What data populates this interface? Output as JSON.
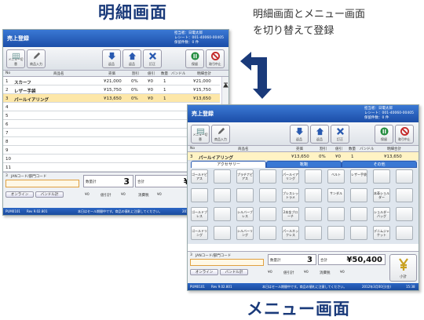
{
  "captions": {
    "detail_title": "明細画面",
    "menu_title": "メニュー画面",
    "description_line1": "明細画面とメニュー画面",
    "description_line2": "を切り替えて登録"
  },
  "window_title": "売上登録",
  "header_info": {
    "staff_label": "担当者",
    "staff_value": "日電太郎",
    "receipt_label": "レシート",
    "receipt_value": "001-40060-00405",
    "stock_label": "保留件数",
    "stock_value": "0 件"
  },
  "toolbar": {
    "menu_switch": "メニュー切替",
    "product_entry": "商品入力",
    "btn_c1": "返品",
    "btn_c2": "返品",
    "btn_c3": "訂正",
    "hold": "保留",
    "cancel": "取引中止"
  },
  "detail_columns": {
    "no": "No",
    "product": "商品名",
    "price": "売価",
    "discount_pct": "割引",
    "discount_amt": "値引",
    "qty": "数量",
    "bundle": "バンドル",
    "amount": "明細合計"
  },
  "detail_rows": [
    {
      "no": "1",
      "name": "スカーフ",
      "price": "¥21,000",
      "pct": "0%",
      "amt": "¥0",
      "qty": "1",
      "total": "¥21,000"
    },
    {
      "no": "2",
      "name": "レザー手袋",
      "price": "¥15,750",
      "pct": "0%",
      "amt": "¥0",
      "qty": "1",
      "total": "¥15,750"
    },
    {
      "no": "3",
      "name": "パールイアリング",
      "price": "¥13,650",
      "pct": "0%",
      "amt": "¥0",
      "qty": "1",
      "total": "¥13,650"
    }
  ],
  "empty_row_numbers": [
    "4",
    "5",
    "6",
    "7",
    "8",
    "9",
    "10",
    "11"
  ],
  "menu_row": {
    "no": "3",
    "name": "パールイアリング",
    "price": "¥13,650",
    "pct": "0%",
    "amt": "¥0",
    "qty": "1",
    "total": "¥13,650"
  },
  "menu_tabs": [
    "アクセサリー",
    "靴鞄",
    "その他"
  ],
  "menu_keys": [
    "ゴールドピアス",
    "",
    "プラチナピアス",
    "",
    "パールイアリング",
    "",
    "ベルト",
    "レザー手袋",
    "",
    "",
    "",
    "",
    "",
    "",
    "ブレスレットラメ",
    "",
    "サンダル",
    "",
    "本革ショルダー",
    "",
    "ゴールドブレス",
    "",
    "シルバーブレス",
    "",
    "2本金ブローチ",
    "",
    "",
    "",
    "ショルダーバッグ",
    "",
    "ゴールドリング",
    "",
    "シルバーリング",
    "",
    "パールネックレス",
    "",
    "",
    "",
    "デニムジャケット",
    ""
  ],
  "bottom": {
    "code_label": "JANコード/部門コード",
    "row_no": "3",
    "qty_label": "数量計",
    "qty_value": "3",
    "total_label": "合計",
    "total_value": "¥50,400",
    "online": "オンライン",
    "bundle_total": "バンドル計",
    "bundle_value": "¥0",
    "discount_total": "値引計",
    "discount_value": "¥0",
    "tax_label": "消費税",
    "tax_value": "¥0",
    "subtotal": "小計"
  },
  "status": {
    "left": "PUM0101",
    "rev": "Rev 9.02.801",
    "message": "本日はセール期間中です。商品の値札に注意してください。",
    "date": "2012年3月00日(金)",
    "time": "15:38"
  },
  "colors": {
    "title_bar": "#2c66c4",
    "selected_row": "#fde7a8",
    "caption": "#1a3a7a"
  }
}
